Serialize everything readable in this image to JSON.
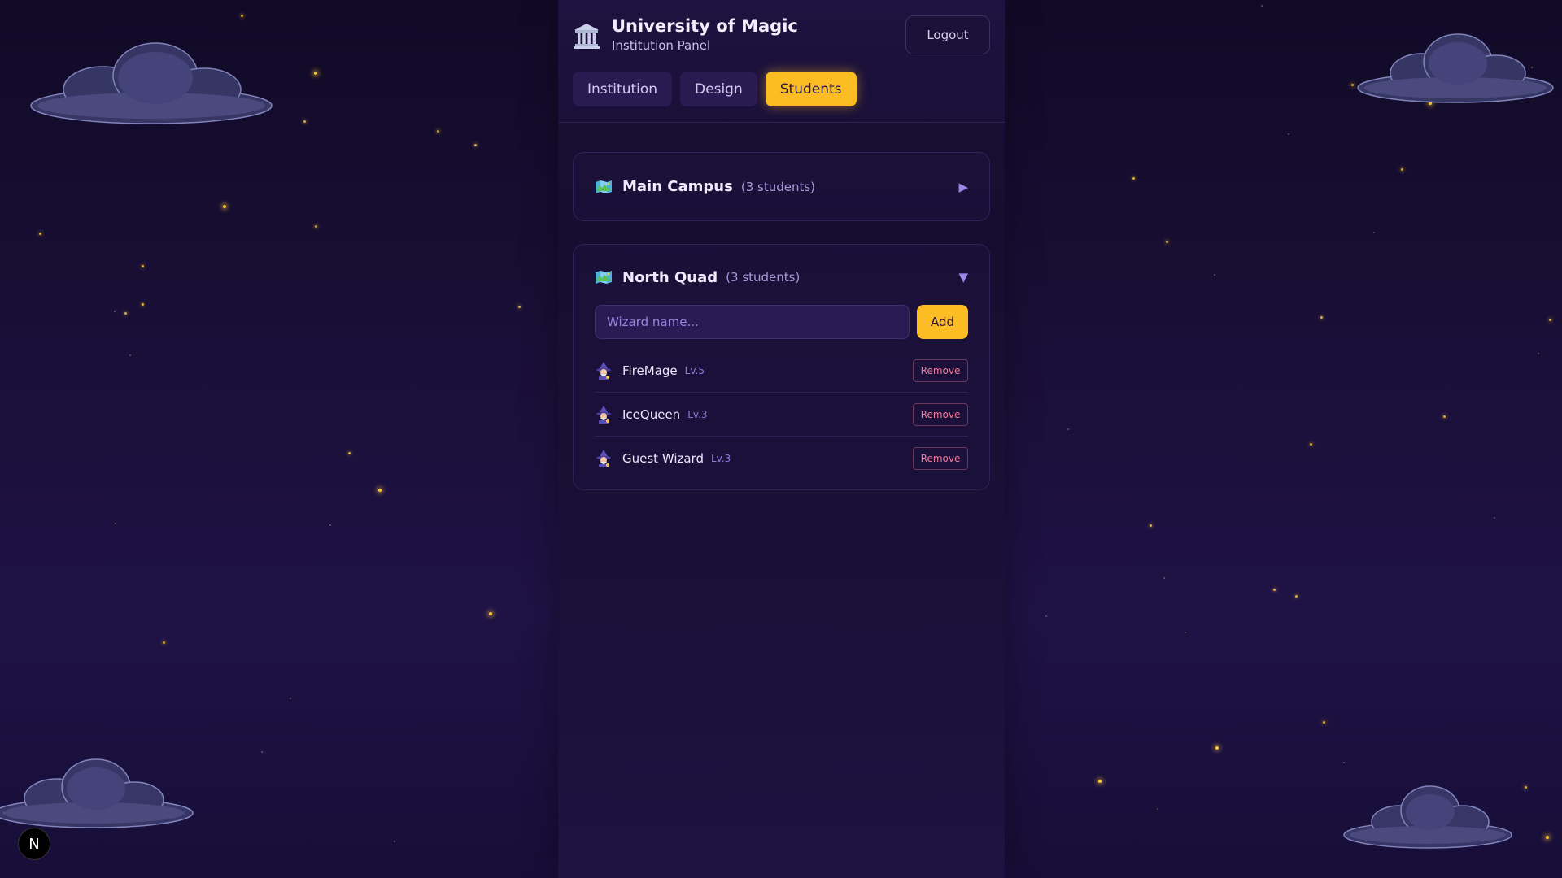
{
  "header": {
    "title": "University of Magic",
    "subtitle": "Institution Panel",
    "logout_label": "Logout"
  },
  "tabs": [
    {
      "label": "Institution",
      "active": false
    },
    {
      "label": "Design",
      "active": false
    },
    {
      "label": "Students",
      "active": true
    }
  ],
  "campuses": [
    {
      "name": "Main Campus",
      "count": "(3 students)",
      "expanded": false,
      "toggle": "▶"
    },
    {
      "name": "North Quad",
      "count": "(3 students)",
      "expanded": true,
      "toggle": "▼",
      "add_placeholder": "Wizard name...",
      "add_label": "Add",
      "students": [
        {
          "name": "FireMage",
          "level": "Lv.5",
          "remove_label": "Remove"
        },
        {
          "name": "IceQueen",
          "level": "Lv.3",
          "remove_label": "Remove"
        },
        {
          "name": "Guest Wizard",
          "level": "Lv.3",
          "remove_label": "Remove"
        }
      ]
    }
  ],
  "badge": {
    "label": "N"
  },
  "colors": {
    "accent": "#fbbd23",
    "background": "#1a0f38",
    "remove": "#f07a98"
  }
}
